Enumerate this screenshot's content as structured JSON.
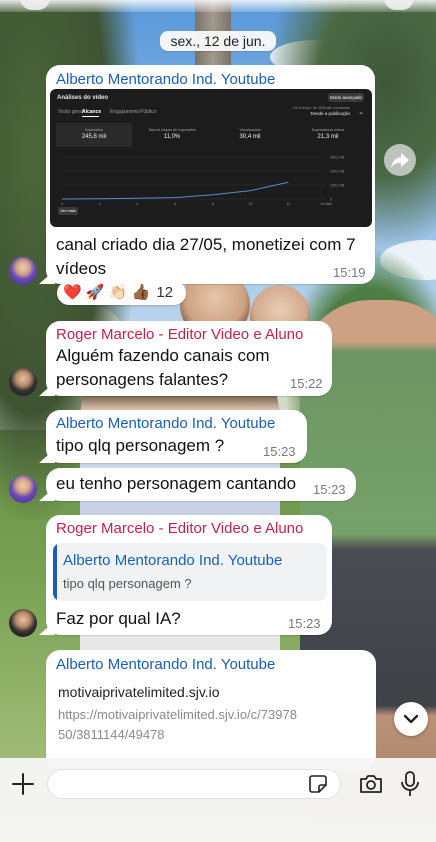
{
  "date_separator": "sex., 12 de jun.",
  "messages": [
    {
      "sender": "Alberto Mentorando Ind. Youtube",
      "attachment": {
        "title": "Análises do vídeo",
        "mode_button": "Modo avançado",
        "tabs": [
          "Visão geral",
          "Alcance",
          "Engajamento",
          "Público"
        ],
        "active_tab": "Alcance",
        "date_range_label": "De 6 de jun. de 2025 até o momento",
        "date_range_value": "Desde a publicação",
        "metrics": [
          {
            "label": "Impressões",
            "value": "245,8 mil"
          },
          {
            "label": "Taxa de cliques de impressões",
            "value": "11,0%"
          },
          {
            "label": "Visualizações",
            "value": "30,4 mil"
          },
          {
            "label": "Espectadores únicos",
            "value": "21,3 mil"
          }
        ],
        "see_more": "Ver mais",
        "chart_data": {
          "type": "line",
          "x": [
            0,
            2,
            4,
            6,
            8,
            10,
            12,
            14
          ],
          "xlabel_ticks": [
            "0",
            "2",
            "4",
            "6",
            "8",
            "10",
            "12",
            "14 dias"
          ],
          "y_ticks": [
            "300,0 mil",
            "200,0 mil",
            "100,0 mil",
            "0"
          ],
          "series": [
            {
              "values": [
                0,
                2000,
                5000,
                10000,
                30000,
                60000,
                120000
              ]
            }
          ],
          "line_color": "#5b8bd4"
        }
      },
      "text": "canal criado dia 27/05, monetizei com 7 vídeos",
      "time": "15:19",
      "reactions": {
        "emojis": "❤️ 🚀 👏🏻 👍🏾",
        "count": "12"
      }
    },
    {
      "sender": "Roger Marcelo - Editor Video e Aluno",
      "text": "Alguém fazendo canais com personagens falantes?",
      "time": "15:22"
    },
    {
      "sender": "Alberto Mentorando Ind. Youtube",
      "text": "tipo qlq personagem ?",
      "time": "15:23"
    },
    {
      "text": "eu tenho personagem cantando",
      "time": "15:23"
    },
    {
      "sender": "Roger Marcelo - Editor Video e Aluno",
      "quote": {
        "name": "Alberto Mentorando Ind. Youtube",
        "text": "tipo qlq personagem ?"
      },
      "text": "Faz por qual IA?",
      "time": "15:23"
    },
    {
      "sender": "Alberto Mentorando Ind. Youtube",
      "link_domain": "motivaiprivatelimited.sjv.io",
      "link_url": "https://motivaiprivatelimited.sjv.io/c/7397850/3811144/49478"
    }
  ],
  "icons": {
    "forward": "forward-arrow-icon",
    "scroll_down": "chevron-down-icon",
    "plus": "plus-icon",
    "sticker": "sticker-icon",
    "camera": "camera-icon",
    "mic": "microphone-icon"
  },
  "colors": {
    "sender_blue": "#1a5fb4",
    "sender_red": "#c4214c",
    "bubble_bg": "#ffffff"
  }
}
